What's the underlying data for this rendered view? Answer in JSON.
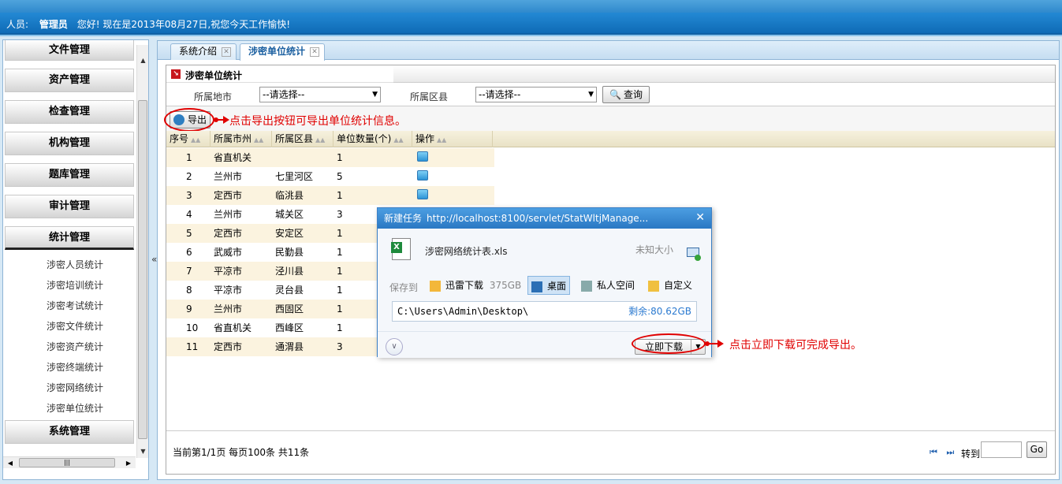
{
  "header": {
    "user_label": "人员:",
    "user_name": "管理员",
    "greeting": "您好!  现在是2013年08月27日,祝您今天工作愉快!"
  },
  "sidebar": {
    "menus_top": [
      "文件管理",
      "资产管理",
      "检查管理",
      "机构管理",
      "题库管理",
      "审计管理",
      "统计管理"
    ],
    "active_menu": "统计管理",
    "sub_items": [
      "涉密人员统计",
      "涉密培训统计",
      "涉密考试统计",
      "涉密文件统计",
      "涉密资产统计",
      "涉密终端统计",
      "涉密网络统计",
      "涉密单位统计"
    ],
    "menus_bottom": [
      "系统管理"
    ],
    "collapse_glyph": "«"
  },
  "tabs": [
    {
      "label": "系统介绍",
      "active": false
    },
    {
      "label": "涉密单位统计",
      "active": true
    }
  ],
  "panel": {
    "title": "涉密单位统计",
    "filters": {
      "city_label": "所属地市",
      "city_value": "--请选择--",
      "county_label": "所属区县",
      "county_value": "--请选择--",
      "query_button": "查询"
    },
    "export_button": "导出",
    "export_annotation": "点击导出按钮可导出单位统计信息。"
  },
  "table": {
    "columns": [
      "序号",
      "所属市州",
      "所属区县",
      "单位数量(个)",
      "操作"
    ],
    "rows": [
      [
        "1",
        "省直机关",
        "",
        "1"
      ],
      [
        "2",
        "兰州市",
        "七里河区",
        "5"
      ],
      [
        "3",
        "定西市",
        "临洮县",
        "1"
      ],
      [
        "4",
        "兰州市",
        "城关区",
        "3"
      ],
      [
        "5",
        "定西市",
        "安定区",
        "1"
      ],
      [
        "6",
        "武威市",
        "民勤县",
        "1"
      ],
      [
        "7",
        "平凉市",
        "泾川县",
        "1"
      ],
      [
        "8",
        "平凉市",
        "灵台县",
        "1"
      ],
      [
        "9",
        "兰州市",
        "西固区",
        "1"
      ],
      [
        "10",
        "省直机关",
        "西峰区",
        "1"
      ],
      [
        "11",
        "定西市",
        "通渭县",
        "3"
      ]
    ]
  },
  "pager": {
    "info": "当前第1/1页  每页100条  共11条",
    "nav": "⏮ ⏭",
    "goto_label": "转到",
    "go_button": "Go"
  },
  "download_dialog": {
    "title": "新建任务",
    "url": "http://localhost:8100/servlet/StatWltjManage...",
    "close": "✕",
    "file_name": "涉密网络统计表.xls",
    "file_size": "未知大小",
    "save_to_label": "保存到",
    "locations": [
      {
        "label": "迅雷下载",
        "extra": "375GB",
        "selected": false
      },
      {
        "label": "桌面",
        "extra": "",
        "selected": true
      },
      {
        "label": "私人空间",
        "extra": "",
        "selected": false
      },
      {
        "label": "自定义",
        "extra": "",
        "selected": false
      }
    ],
    "path": "C:\\Users\\Admin\\Desktop\\",
    "remaining": "剩余:80.62GB",
    "download_button": "立即下载",
    "download_annotation": "点击立即下载可完成导出。"
  }
}
